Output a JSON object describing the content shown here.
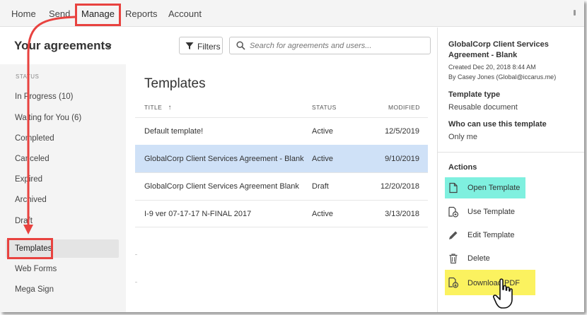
{
  "nav": {
    "items": [
      "Home",
      "Send",
      "Manage",
      "Reports",
      "Account"
    ]
  },
  "header": {
    "title": "Your agreements",
    "filters_label": "Filters",
    "search_placeholder": "Search for agreements and users..."
  },
  "sidebar": {
    "section_label": "STATUS",
    "items": [
      {
        "label": "In Progress (10)"
      },
      {
        "label": "Waiting for You (6)"
      },
      {
        "label": "Completed"
      },
      {
        "label": "Canceled"
      },
      {
        "label": "Expired"
      },
      {
        "label": "Archived"
      },
      {
        "label": "Draft"
      },
      {
        "label": "Templates"
      },
      {
        "label": "Web Forms"
      },
      {
        "label": "Mega Sign"
      }
    ]
  },
  "table": {
    "title": "Templates",
    "col_title": "TITLE",
    "sort_arrow": "↑",
    "col_status": "STATUS",
    "col_modified": "MODIFIED",
    "rows": [
      {
        "title": "Default template!",
        "status": "Active",
        "modified": "12/5/2019"
      },
      {
        "title": "GlobalCorp Client Services Agreement - Blank",
        "status": "Active",
        "modified": "9/10/2019"
      },
      {
        "title": "GlobalCorp Client Services Agreement Blank",
        "status": "Draft",
        "modified": "12/20/2018"
      },
      {
        "title": "I-9 ver 07-17-17 N-FINAL 2017",
        "status": "Active",
        "modified": "3/13/2018"
      }
    ]
  },
  "details": {
    "title": "GlobalCorp Client Services Agreement - Blank",
    "created": "Created Dec 20, 2018 8:44 AM",
    "by": "By Casey Jones (Global@iccarus.me)",
    "type_label": "Template type",
    "type_value": "Reusable document",
    "who_label": "Who can use this template",
    "who_value": "Only me",
    "actions_label": "Actions",
    "actions": [
      {
        "label": "Open Template",
        "icon": "document-icon"
      },
      {
        "label": "Use Template",
        "icon": "use-template-icon"
      },
      {
        "label": "Edit Template",
        "icon": "pencil-icon"
      },
      {
        "label": "Delete",
        "icon": "trash-icon"
      },
      {
        "label": "Download PDF",
        "icon": "download-pdf-icon"
      }
    ]
  },
  "colors": {
    "annotation_red": "#e8423f",
    "selected_row": "#cfe1f7",
    "highlight_cyan": "#7ff0df",
    "highlight_yellow": "#fbf25f"
  }
}
